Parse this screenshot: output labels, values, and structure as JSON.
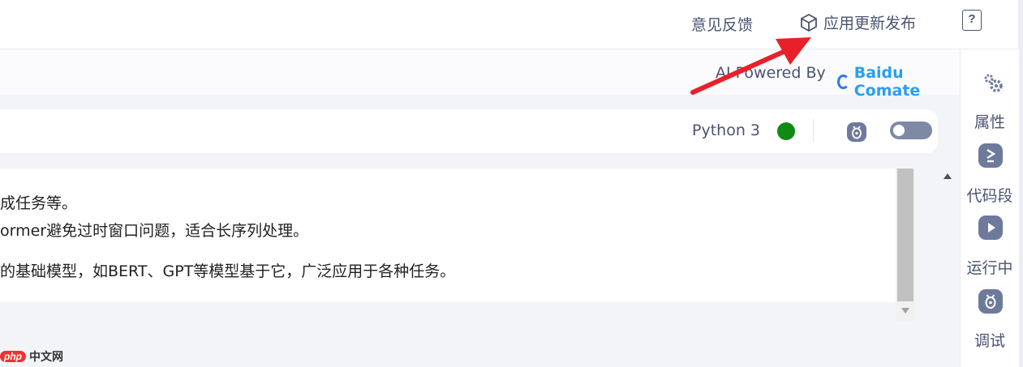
{
  "header": {
    "feedback_label": "意见反馈",
    "publish_label": "应用更新发布",
    "help_label": "?"
  },
  "ai_strip": {
    "powered_by": "AI Powered By",
    "brand": "Baidu Comate"
  },
  "kernel": {
    "name": "Python 3",
    "status_color": "#0f8a12"
  },
  "output": {
    "lines": [
      "成任务等。",
      "ormer避免过时窗口问题，适合长序列处理。",
      "的基础模型，如BERT、GPT等模型基于它，广泛应用于各种任务。"
    ]
  },
  "sidebar": {
    "items": [
      {
        "label": "属性",
        "icon": "gears-icon"
      },
      {
        "label": "代码段",
        "icon": "code-snippet-icon"
      },
      {
        "label": "运行中",
        "icon": "play-icon"
      },
      {
        "label": "调试",
        "icon": "debug-icon"
      }
    ]
  },
  "watermark": {
    "logo": "php",
    "text": "中文网"
  },
  "colors": {
    "annotation_arrow": "#e8202a",
    "accent": "#6d7a9c"
  }
}
